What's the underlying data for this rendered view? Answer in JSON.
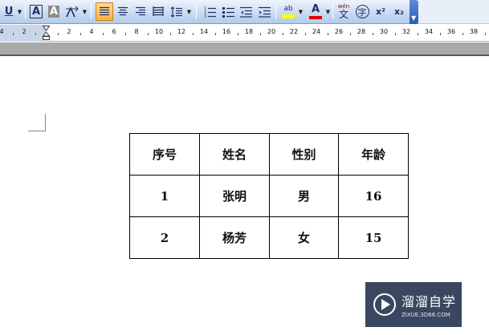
{
  "toolbar": {
    "underline_label": "U",
    "char_border_label": "A",
    "char_shading_label": "A",
    "superscript_label": "x²",
    "subscript_label": "x₂",
    "phonetic_top": "wén",
    "phonetic_bottom": "文",
    "enclose_char": "字",
    "highlight_label": "ab",
    "font_color_label": "A"
  },
  "ruler": {
    "labels": [
      "4",
      "2",
      "2",
      "4",
      "6",
      "8",
      "10",
      "12",
      "14",
      "16",
      "18",
      "20",
      "22",
      "24",
      "26",
      "28",
      "30",
      "32",
      "34",
      "36",
      "38"
    ]
  },
  "table": {
    "rows": [
      [
        "序号",
        "姓名",
        "性别",
        "年龄"
      ],
      [
        "1",
        "张明",
        "男",
        "16"
      ],
      [
        "2",
        "杨芳",
        "女",
        "15"
      ]
    ]
  },
  "watermark": {
    "title": "溜溜自学",
    "url": "ZIXUE.3D66.COM"
  },
  "colors": {
    "toolbar_bg": "#c7d9f2",
    "active_button": "#ffb13d",
    "watermark_bg": "#283852",
    "highlight_yellow": "#ffff00",
    "font_color_red": "#e00000"
  }
}
